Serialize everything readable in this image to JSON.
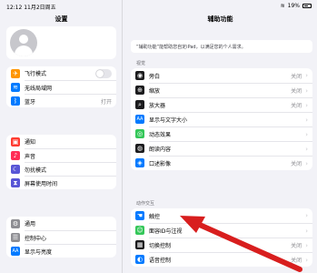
{
  "status": {
    "time": "12:12",
    "date": "11月2日周五",
    "battery": "19%"
  },
  "sidebar": {
    "title": "设置",
    "group1": [
      {
        "label": "飞行模式",
        "icon": "airplane-icon",
        "color": "#ff9500",
        "glyph": "✈",
        "toggle": true
      },
      {
        "label": "无线局域网",
        "icon": "wifi-icon",
        "color": "#007aff",
        "glyph": "≋",
        "value": ""
      },
      {
        "label": "蓝牙",
        "icon": "bluetooth-icon",
        "color": "#007aff",
        "glyph": "ᛒ",
        "value": "打开"
      }
    ],
    "group2": [
      {
        "label": "通知",
        "icon": "notifications-icon",
        "color": "#ff3b30",
        "glyph": "▣"
      },
      {
        "label": "声音",
        "icon": "sound-icon",
        "color": "#ff2d55",
        "glyph": "♪"
      },
      {
        "label": "勿扰模式",
        "icon": "moon-icon",
        "color": "#5856d6",
        "glyph": "☾"
      },
      {
        "label": "屏幕使用时间",
        "icon": "hourglass-icon",
        "color": "#5856d6",
        "glyph": "⧗"
      }
    ],
    "group3": [
      {
        "label": "通用",
        "icon": "gear-icon",
        "color": "#8e8e93",
        "glyph": "⚙"
      },
      {
        "label": "控制中心",
        "icon": "control-center-icon",
        "color": "#8e8e93",
        "glyph": "☰"
      },
      {
        "label": "显示与亮度",
        "icon": "brightness-icon",
        "color": "#007aff",
        "glyph": "AA"
      }
    ]
  },
  "main": {
    "title": "辅助功能",
    "intro": "“辅助功能”能帮助您自定iPad，以满足您的个人需求。",
    "section_vision": "视觉",
    "vision": [
      {
        "label": "旁白",
        "icon": "voiceover-icon",
        "color": "#1c1c1e",
        "glyph": "◉",
        "value": "关闭"
      },
      {
        "label": "缩放",
        "icon": "zoom-icon",
        "color": "#1c1c1e",
        "glyph": "⊕",
        "value": "关闭"
      },
      {
        "label": "放大器",
        "icon": "magnifier-icon",
        "color": "#1c1c1e",
        "glyph": "⌕",
        "value": "关闭"
      },
      {
        "label": "显示与文字大小",
        "icon": "text-size-icon",
        "color": "#007aff",
        "glyph": "AA",
        "value": ""
      },
      {
        "label": "动态效果",
        "icon": "motion-icon",
        "color": "#34c759",
        "glyph": "◎",
        "value": ""
      },
      {
        "label": "朗读内容",
        "icon": "speech-icon",
        "color": "#1c1c1e",
        "glyph": "◍",
        "value": ""
      },
      {
        "label": "口述影像",
        "icon": "audio-description-icon",
        "color": "#007aff",
        "glyph": "◈",
        "value": "关闭"
      }
    ],
    "section_interaction": "动作交互",
    "interaction": [
      {
        "label": "触控",
        "icon": "touch-icon",
        "color": "#007aff",
        "glyph": "☚",
        "value": ""
      },
      {
        "label": "面容ID与注视",
        "icon": "face-id-icon",
        "color": "#34c759",
        "glyph": "☺",
        "value": ""
      },
      {
        "label": "切换控制",
        "icon": "switch-control-icon",
        "color": "#1c1c1e",
        "glyph": "▦",
        "value": "关闭"
      },
      {
        "label": "语音控制",
        "icon": "voice-control-icon",
        "color": "#007aff",
        "glyph": "◐",
        "value": "关闭"
      }
    ]
  }
}
